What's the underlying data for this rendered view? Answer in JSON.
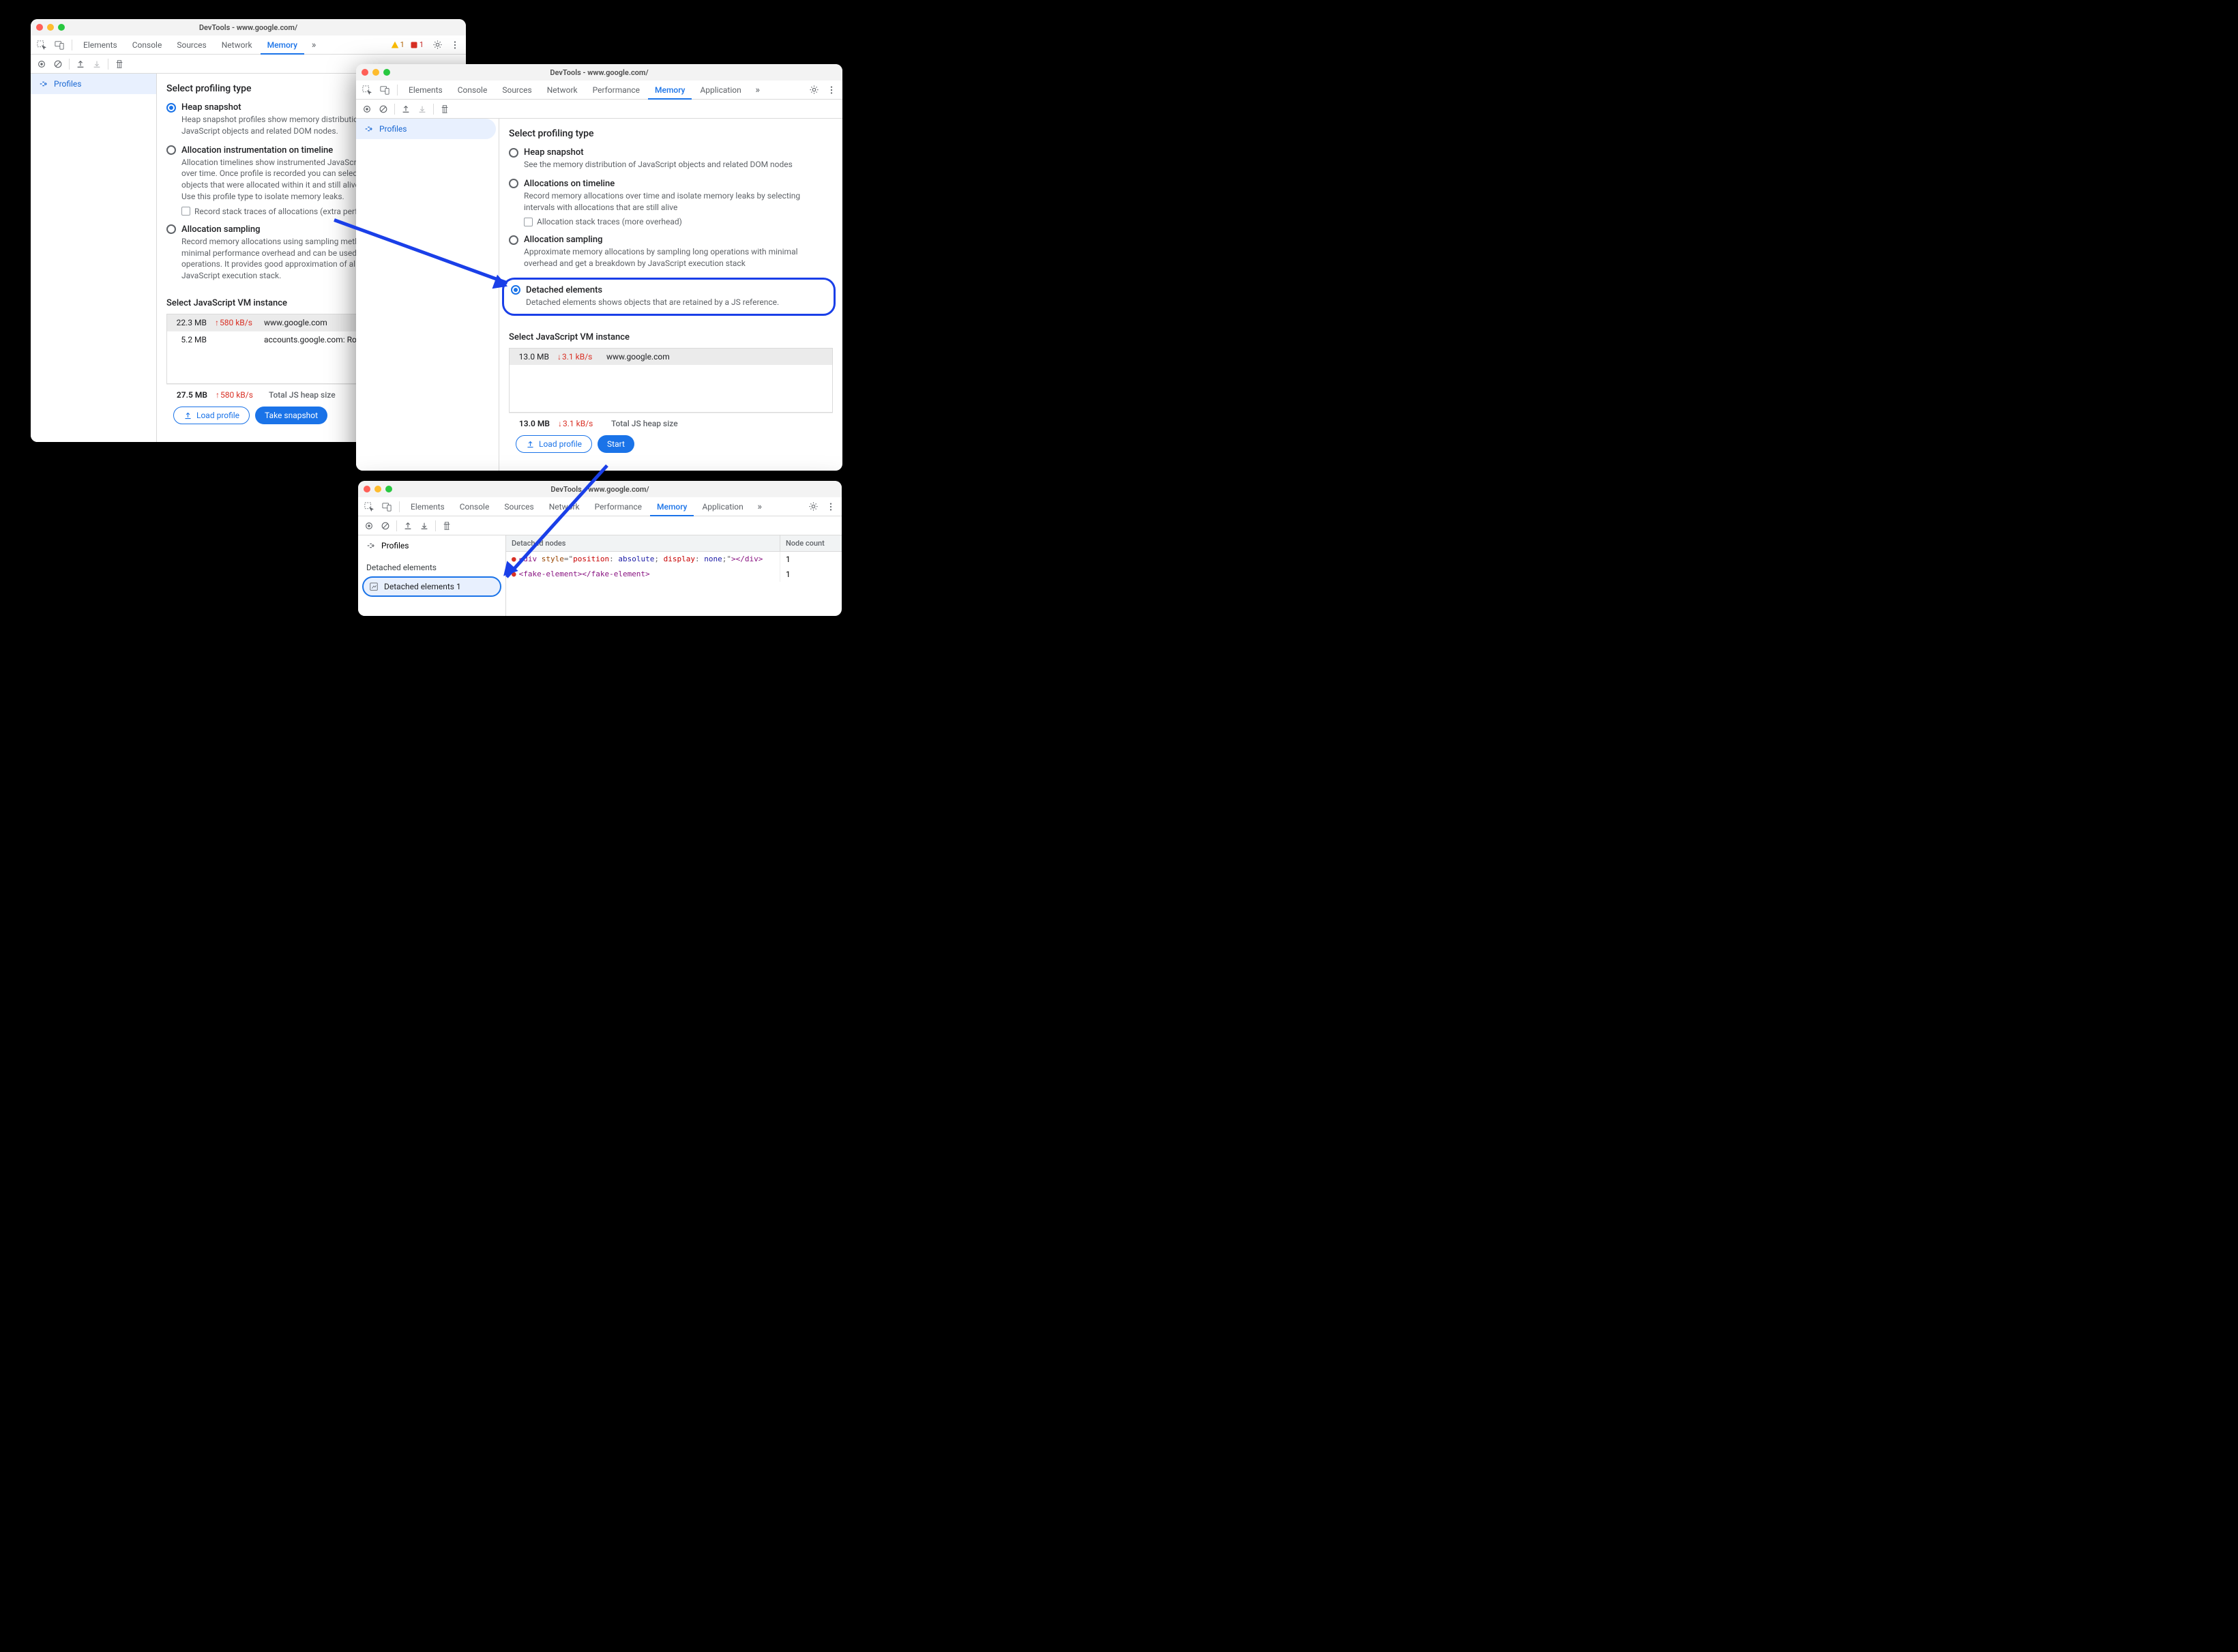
{
  "window1": {
    "title": "DevTools - www.google.com/",
    "tabs": [
      "Elements",
      "Console",
      "Sources",
      "Network",
      "Memory"
    ],
    "active_tab": "Memory",
    "warn_count": "1",
    "err_count": "1",
    "sidebar_item": "Profiles",
    "heading": "Select profiling type",
    "opt1_title": "Heap snapshot",
    "opt1_desc": "Heap snapshot profiles show memory distribution among your page's JavaScript objects and related DOM nodes.",
    "opt2_title": "Allocation instrumentation on timeline",
    "opt2_desc": "Allocation timelines show instrumented JavaScript memory allocations over time. Once profile is recorded you can select a time interval to see objects that were allocated within it and still alive by the end of recording. Use this profile type to isolate memory leaks.",
    "opt2_checkbox": "Record stack traces of allocations (extra performance overhead)",
    "opt3_title": "Allocation sampling",
    "opt3_desc": "Record memory allocations using sampling method. This profile type has minimal performance overhead and can be used for long running operations. It provides good approximation of allocations broken down by JavaScript execution stack.",
    "vm_heading": "Select JavaScript VM instance",
    "vm_rows": [
      {
        "size": "22.3 MB",
        "rate": "580 kB/s",
        "host": "www.google.com"
      },
      {
        "size": "5.2 MB",
        "rate": "",
        "host": "accounts.google.com: RotateCookiesPage"
      }
    ],
    "total_size": "27.5 MB",
    "total_rate": "580 kB/s",
    "total_label": "Total JS heap size",
    "btn_load": "Load profile",
    "btn_action": "Take snapshot"
  },
  "window2": {
    "title": "DevTools - www.google.com/",
    "tabs": [
      "Elements",
      "Console",
      "Sources",
      "Network",
      "Performance",
      "Memory",
      "Application"
    ],
    "active_tab": "Memory",
    "sidebar_item": "Profiles",
    "heading": "Select profiling type",
    "opt1_title": "Heap snapshot",
    "opt1_desc": "See the memory distribution of JavaScript objects and related DOM nodes",
    "opt2_title": "Allocations on timeline",
    "opt2_desc": "Record memory allocations over time and isolate memory leaks by selecting intervals with allocations that are still alive",
    "opt2_checkbox": "Allocation stack traces (more overhead)",
    "opt3_title": "Allocation sampling",
    "opt3_desc": "Approximate memory allocations by sampling long operations with minimal overhead and get a breakdown by JavaScript execution stack",
    "opt4_title": "Detached elements",
    "opt4_desc": "Detached elements shows objects that are retained by a JS reference.",
    "vm_heading": "Select JavaScript VM instance",
    "vm_rows": [
      {
        "size": "13.0 MB",
        "rate": "3.1 kB/s",
        "host": "www.google.com"
      }
    ],
    "total_size": "13.0 MB",
    "total_rate": "3.1 kB/s",
    "total_label": "Total JS heap size",
    "btn_load": "Load profile",
    "btn_action": "Start"
  },
  "window3": {
    "title": "DevTools - www.google.com/",
    "tabs": [
      "Elements",
      "Console",
      "Sources",
      "Network",
      "Performance",
      "Memory",
      "Application"
    ],
    "active_tab": "Memory",
    "sidebar_item": "Profiles",
    "sidebar_heading": "Detached elements",
    "sidebar_selected": "Detached elements 1",
    "col1": "Detached nodes",
    "col2": "Node count",
    "rows": [
      {
        "html": "<div style=\"position: absolute; display: none;\"></div>",
        "count": "1"
      },
      {
        "html": "<fake-element></fake-element>",
        "count": "1"
      }
    ]
  }
}
